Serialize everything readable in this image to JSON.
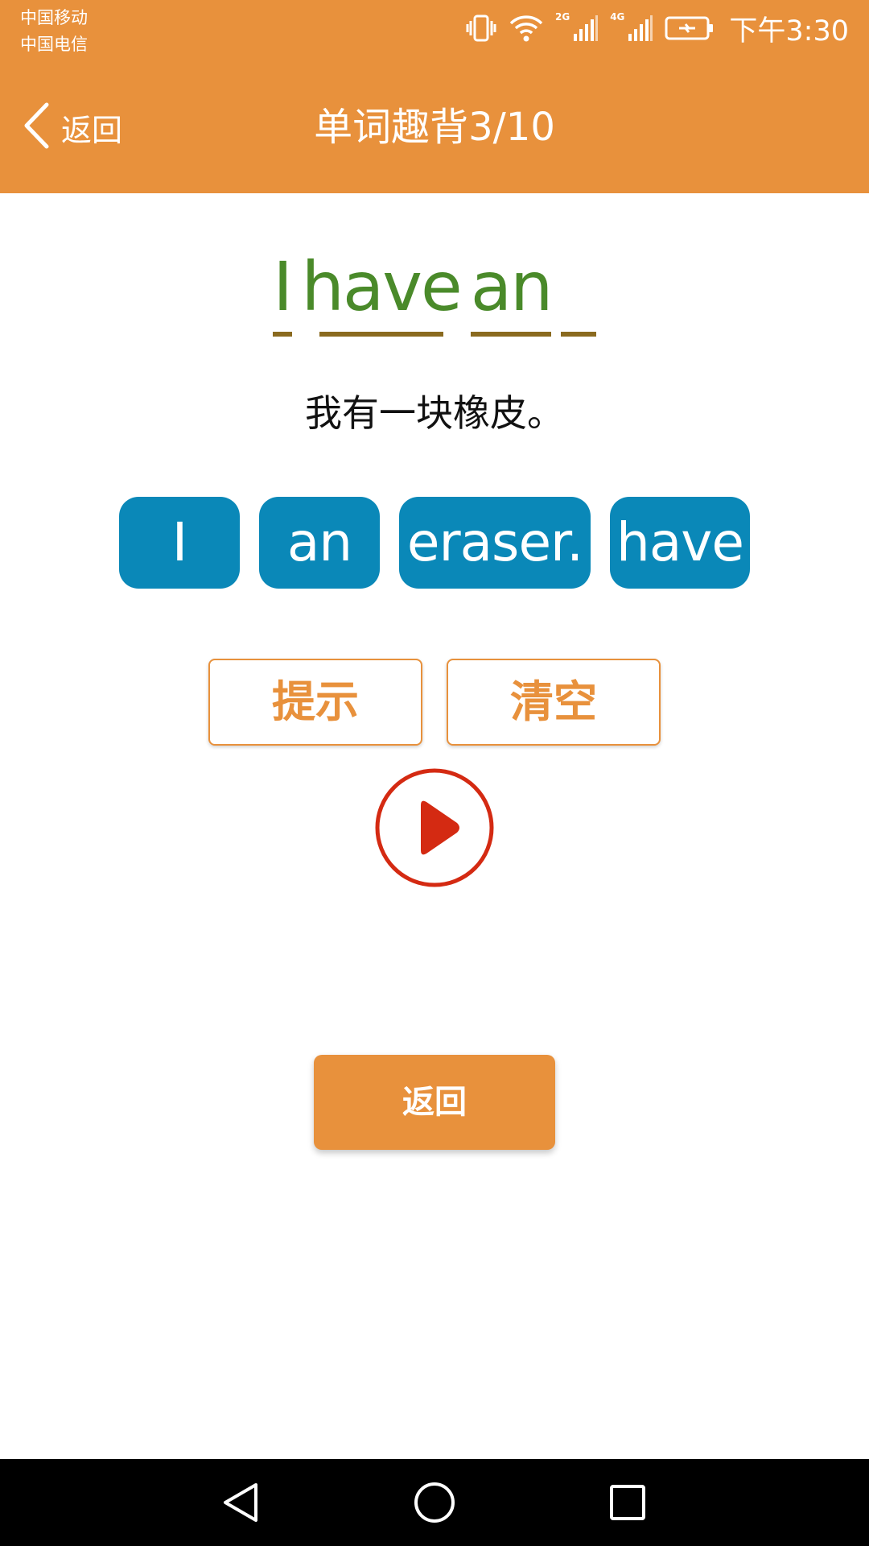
{
  "status_bar": {
    "carrier_1": "中国移动",
    "carrier_2": "中国电信",
    "net_1": "2G",
    "net_2": "4G",
    "time": "下午3:30",
    "icons": [
      "vibrate-icon",
      "wifi-icon",
      "signal-icon",
      "signal-icon",
      "battery-charging-icon"
    ]
  },
  "header": {
    "back_label": "返回",
    "title": "单词趣背3/10",
    "background_color": "#E8913C"
  },
  "answer": {
    "slots": [
      {
        "word": "I"
      },
      {
        "word": "have"
      },
      {
        "word": "an"
      },
      {
        "word": ""
      }
    ],
    "word_color": "#4A8A2A"
  },
  "translation": "我有一块橡皮。",
  "word_tiles": [
    {
      "label": "I"
    },
    {
      "label": "an"
    },
    {
      "label": "eraser."
    },
    {
      "label": "have"
    }
  ],
  "actions": {
    "hint_label": "提示",
    "clear_label": "清空",
    "play_icon": "play-icon",
    "play_color": "#D42A12"
  },
  "return_button_label": "返回",
  "nav_bar": {
    "icons": [
      "nav-back-icon",
      "nav-home-icon",
      "nav-recent-icon"
    ]
  }
}
